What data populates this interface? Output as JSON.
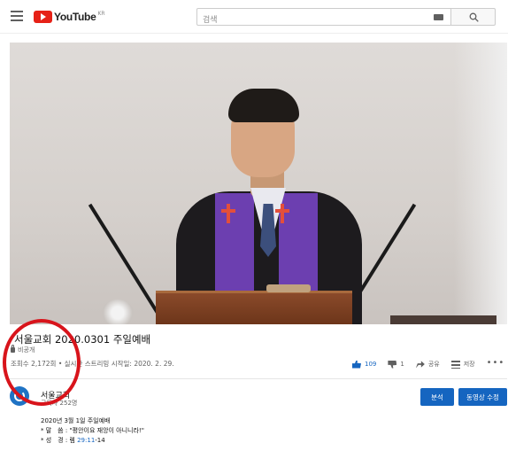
{
  "header": {
    "logo_text": "YouTube",
    "logo_region": "KR",
    "search_placeholder": "검색"
  },
  "video": {
    "title": "서울교회 2020.0301 주일예배",
    "privacy": "비공개",
    "meta": "조회수 2,172회 • 실시간 스트리밍 시작일: 2020. 2. 29.",
    "like_count": "109",
    "dislike_count": "1",
    "share_label": "공유",
    "save_label": "저장",
    "more_label": "•••"
  },
  "channel": {
    "name": "서울교회",
    "subscribers": "구독자 252명"
  },
  "buttons": {
    "analytics": "분석",
    "edit_video": "동영상 수정"
  },
  "description": {
    "line1": "2020년 3월 1일 주일예배",
    "line2_prefix": "* 말　씀 : ",
    "line2_text": "\"평안이요 재앙이 아니니라!\"",
    "line3_prefix": "* 성　경 : 렘 ",
    "line3_link": "29:11",
    "line3_suffix": "-14"
  },
  "colors": {
    "brand_red": "#e62117",
    "accent_blue": "#1565c0",
    "annotation_red": "#d8141b",
    "stole_purple": "#6c3fb0"
  }
}
